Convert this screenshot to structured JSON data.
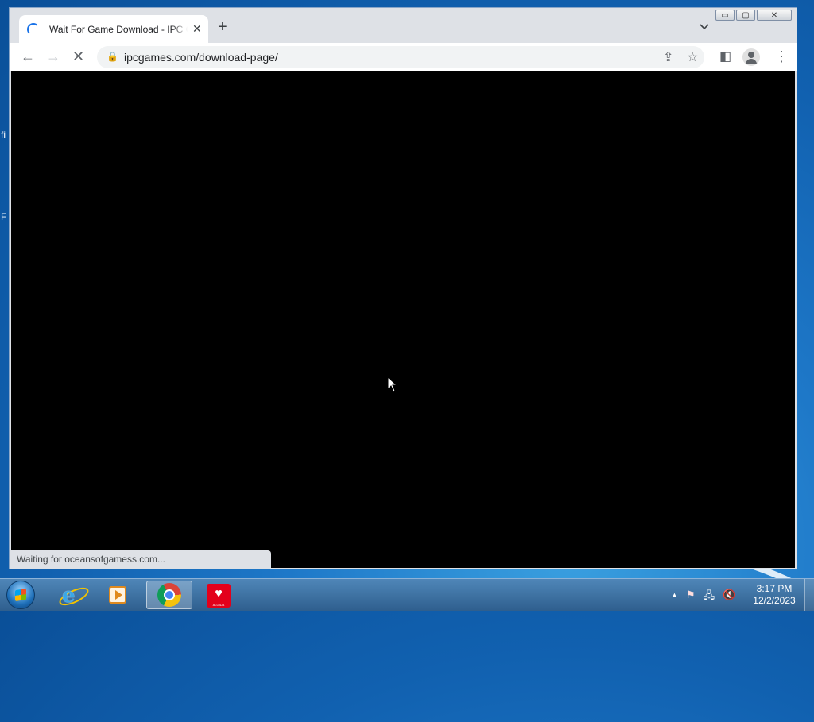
{
  "desktop": {
    "fragments": [
      "fi",
      "F"
    ]
  },
  "browser": {
    "tab": {
      "title": "Wait For Game Download - IPC Games",
      "close": "✕"
    },
    "new_tab": "+",
    "caption": {
      "minimize": "▭",
      "maximize": "▢",
      "close": "✕"
    },
    "toolbar": {
      "back": "←",
      "forward": "→",
      "stop": "✕",
      "url": "ipcgames.com/download-page/",
      "lock": "🔒",
      "share": "⇪",
      "star": "☆",
      "sidepanel": "◧",
      "menu": "⋮"
    },
    "status_text": "Waiting for oceansofgamess.com..."
  },
  "taskbar": {
    "apps": [
      {
        "name": "Internet Explorer",
        "icon": "ie-icon",
        "active": false
      },
      {
        "name": "Windows Media Player",
        "icon": "media-player-icon",
        "active": false
      },
      {
        "name": "Google Chrome",
        "icon": "chrome-icon",
        "active": true
      },
      {
        "name": "Algida",
        "icon": "algida-icon",
        "active": false
      }
    ],
    "algida_label": "ALGIDA",
    "tray": {
      "arrow": "▲",
      "flag": "⚑",
      "network": "🖧",
      "volume": "🔇"
    },
    "clock": {
      "time": "3:17 PM",
      "date": "12/2/2023"
    }
  },
  "colors": {
    "accent": "#1a73e8",
    "viewport": "#000000",
    "taskbar": "#3a6e9f"
  }
}
